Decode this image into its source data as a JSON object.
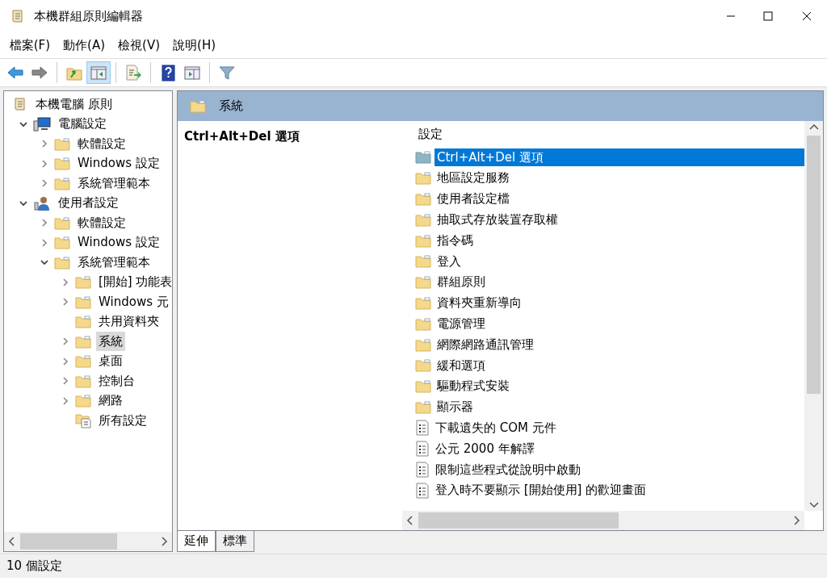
{
  "window": {
    "title": "本機群組原則編輯器"
  },
  "menu": [
    "檔案(F)",
    "動作(A)",
    "檢視(V)",
    "說明(H)"
  ],
  "toolbar": [
    {
      "kind": "back",
      "pressed": false
    },
    {
      "kind": "forward",
      "pressed": false
    },
    {
      "kind": "up",
      "pressed": false
    },
    {
      "kind": "tree",
      "pressed": true
    },
    {
      "kind": "export",
      "pressed": false
    },
    {
      "kind": "help",
      "pressed": false
    },
    {
      "kind": "pane",
      "pressed": false
    },
    {
      "kind": "filter",
      "pressed": false
    }
  ],
  "tree": [
    {
      "kind": "policy",
      "label": "本機電腦 原則",
      "selected": false,
      "children": [
        {
          "kind": "computer",
          "label": "電腦設定",
          "expanded": true,
          "selected": false,
          "children": [
            {
              "kind": "folder",
              "label": "軟體設定",
              "expanded": false,
              "selected": false
            },
            {
              "kind": "folder",
              "label": "Windows 設定",
              "expanded": false,
              "selected": false
            },
            {
              "kind": "folder",
              "label": "系統管理範本",
              "expanded": false,
              "selected": false
            }
          ]
        },
        {
          "kind": "user",
          "label": "使用者設定",
          "expanded": true,
          "selected": false,
          "children": [
            {
              "kind": "folder",
              "label": "軟體設定",
              "expanded": false,
              "selected": false
            },
            {
              "kind": "folder",
              "label": "Windows 設定",
              "expanded": false,
              "selected": false
            },
            {
              "kind": "folder",
              "label": "系統管理範本",
              "expanded": true,
              "selected": false,
              "children": [
                {
                  "kind": "folder",
                  "label": "[開始] 功能表",
                  "expanded": false,
                  "selected": false
                },
                {
                  "kind": "folder",
                  "label": "Windows 元",
                  "expanded": false,
                  "selected": false
                },
                {
                  "kind": "folder",
                  "label": "共用資料夾",
                  "selected": false
                },
                {
                  "kind": "folder",
                  "label": "系統",
                  "expanded": false,
                  "selected": true
                },
                {
                  "kind": "folder",
                  "label": "桌面",
                  "expanded": false,
                  "selected": false
                },
                {
                  "kind": "folder",
                  "label": "控制台",
                  "expanded": false,
                  "selected": false
                },
                {
                  "kind": "folder",
                  "label": "網路",
                  "expanded": false,
                  "selected": false
                },
                {
                  "kind": "all",
                  "label": "所有設定",
                  "selected": false
                }
              ]
            }
          ]
        }
      ]
    }
  ],
  "header": {
    "title": "系統"
  },
  "description": {
    "title": "Ctrl+Alt+Del 選項"
  },
  "list": {
    "column": "設定",
    "items": [
      {
        "kind": "folder",
        "label": "Ctrl+Alt+Del 選項",
        "selected": true
      },
      {
        "kind": "folder",
        "label": "地區設定服務",
        "selected": false
      },
      {
        "kind": "folder",
        "label": "使用者設定檔",
        "selected": false
      },
      {
        "kind": "folder",
        "label": "抽取式存放裝置存取權",
        "selected": false
      },
      {
        "kind": "folder",
        "label": "指令碼",
        "selected": false
      },
      {
        "kind": "folder",
        "label": "登入",
        "selected": false
      },
      {
        "kind": "folder",
        "label": "群組原則",
        "selected": false
      },
      {
        "kind": "folder",
        "label": "資料夾重新導向",
        "selected": false
      },
      {
        "kind": "folder",
        "label": "電源管理",
        "selected": false
      },
      {
        "kind": "folder",
        "label": "網際網路通訊管理",
        "selected": false
      },
      {
        "kind": "folder",
        "label": "緩和選項",
        "selected": false
      },
      {
        "kind": "folder",
        "label": "驅動程式安裝",
        "selected": false
      },
      {
        "kind": "folder",
        "label": "顯示器",
        "selected": false
      },
      {
        "kind": "setting",
        "label": "下載遺失的 COM 元件",
        "selected": false
      },
      {
        "kind": "setting",
        "label": "公元 2000 年解譯",
        "selected": false
      },
      {
        "kind": "setting",
        "label": "限制這些程式從說明中啟動",
        "selected": false
      },
      {
        "kind": "setting",
        "label": "登入時不要顯示 [開始使用] 的歡迎畫面",
        "selected": false
      }
    ]
  },
  "tabs": [
    {
      "label": "延伸",
      "selected": true
    },
    {
      "label": "標準",
      "selected": false
    }
  ],
  "status_bar": "10 個設定"
}
